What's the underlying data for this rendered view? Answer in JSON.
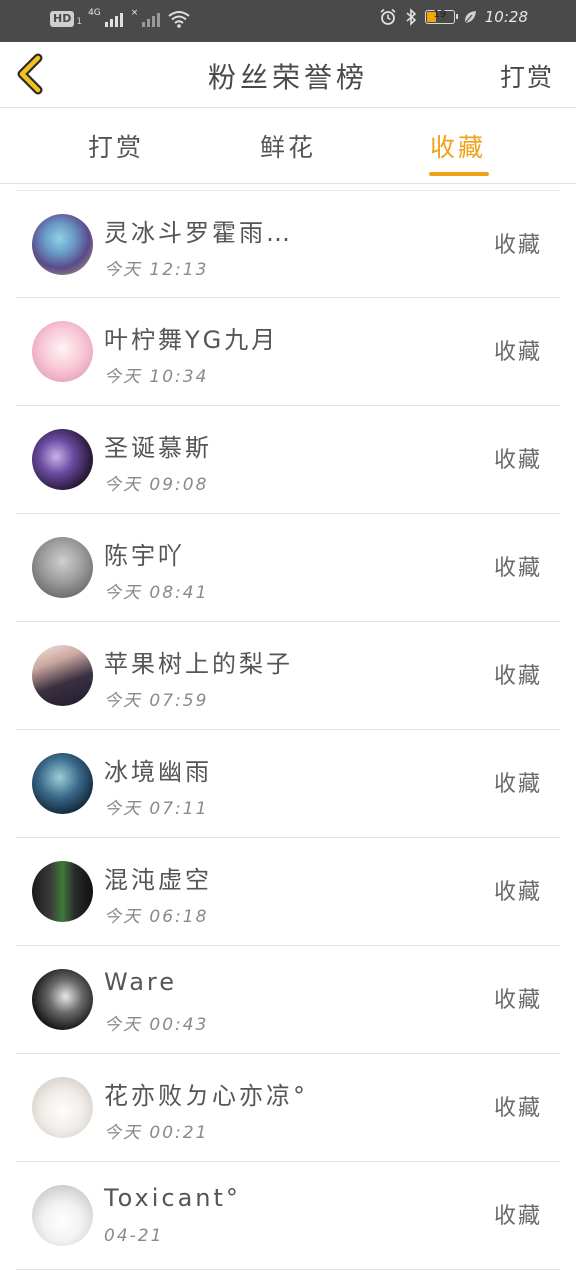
{
  "status_bar": {
    "hd": "HD",
    "hd_sub": "1",
    "network": "4G",
    "signal2_mark": "×",
    "time": "10:28",
    "battery_level": "19"
  },
  "header": {
    "title": "粉丝荣誉榜",
    "action": "打赏"
  },
  "tabs": [
    {
      "label": "打赏",
      "active": false
    },
    {
      "label": "鲜花",
      "active": false
    },
    {
      "label": "收藏",
      "active": true
    }
  ],
  "colors": {
    "accent": "#f0a21a",
    "status_bar": "#4a4a4a"
  },
  "fans": [
    {
      "name": "灵冰斗罗霍雨…",
      "time": "今天 12:13",
      "tag": "收藏"
    },
    {
      "name": "叶柠舞YG九月",
      "time": "今天 10:34",
      "tag": "收藏"
    },
    {
      "name": "圣诞慕斯",
      "time": "今天 09:08",
      "tag": "收藏"
    },
    {
      "name": "陈宇吖",
      "time": "今天 08:41",
      "tag": "收藏"
    },
    {
      "name": "苹果树上的梨子",
      "time": "今天 07:59",
      "tag": "收藏"
    },
    {
      "name": "冰境幽雨",
      "time": "今天 07:11",
      "tag": "收藏"
    },
    {
      "name": "混沌虚空",
      "time": "今天 06:18",
      "tag": "收藏"
    },
    {
      "name": "Ware",
      "time": "今天 00:43",
      "tag": "收藏"
    },
    {
      "name": "花亦败ㄉ心亦凉°",
      "time": "今天 00:21",
      "tag": "收藏"
    },
    {
      "name": "Toxicant°",
      "time": "04-21",
      "tag": "收藏"
    }
  ]
}
